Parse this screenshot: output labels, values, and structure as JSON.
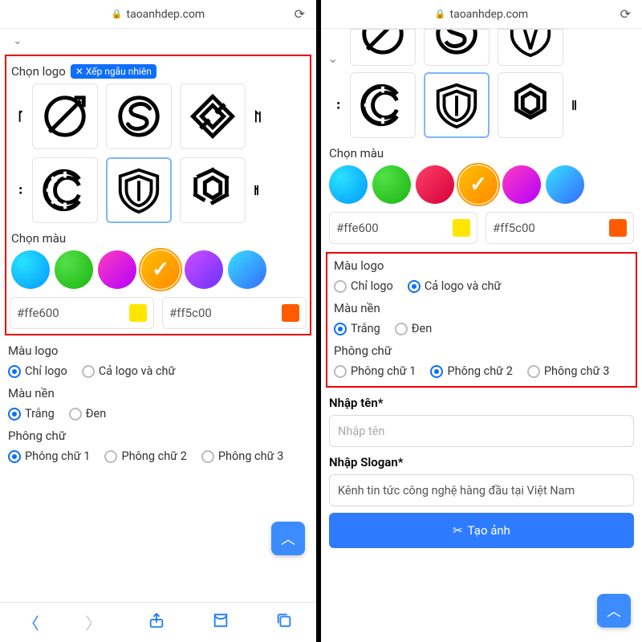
{
  "browser": {
    "domain": "taoanhdep.com"
  },
  "left": {
    "logo_section_title": "Chọn logo",
    "shuffle_label": "Xếp ngẫu nhiên",
    "color_section_title": "Chọn màu",
    "hex1": "#ffe600",
    "hex2": "#ff5c00",
    "group_logo_color_title": "Màu logo",
    "opt_logo_only": "Chỉ logo",
    "opt_logo_and_text": "Cả logo và chữ",
    "group_bg_title": "Màu nền",
    "opt_white": "Trắng",
    "opt_black": "Đen",
    "group_font_title": "Phông chữ",
    "opt_font1": "Phông chữ 1",
    "opt_font2": "Phông chữ 2",
    "opt_font3": "Phông chữ 3"
  },
  "right": {
    "color_section_title": "Chọn màu",
    "hex1": "#ffe600",
    "hex2": "#ff5c00",
    "group_logo_color_title": "Màu logo",
    "opt_logo_only": "Chỉ logo",
    "opt_logo_and_text": "Cả logo và chữ",
    "group_bg_title": "Màu nền",
    "opt_white": "Trắng",
    "opt_black": "Đen",
    "group_font_title": "Phông chữ",
    "opt_font1": "Phông chữ 1",
    "opt_font2": "Phông chữ 2",
    "opt_font3": "Phông chữ 3",
    "name_label": "Nhập tên*",
    "name_placeholder": "Nhập tên",
    "slogan_label": "Nhập Slogan*",
    "slogan_value": "Kênh tin tức công nghệ hàng đầu tại Việt Nam",
    "create_label": "Tạo ảnh"
  },
  "colors": {
    "yellow_chip": "#ffe600",
    "orange_chip": "#ff5c00"
  }
}
